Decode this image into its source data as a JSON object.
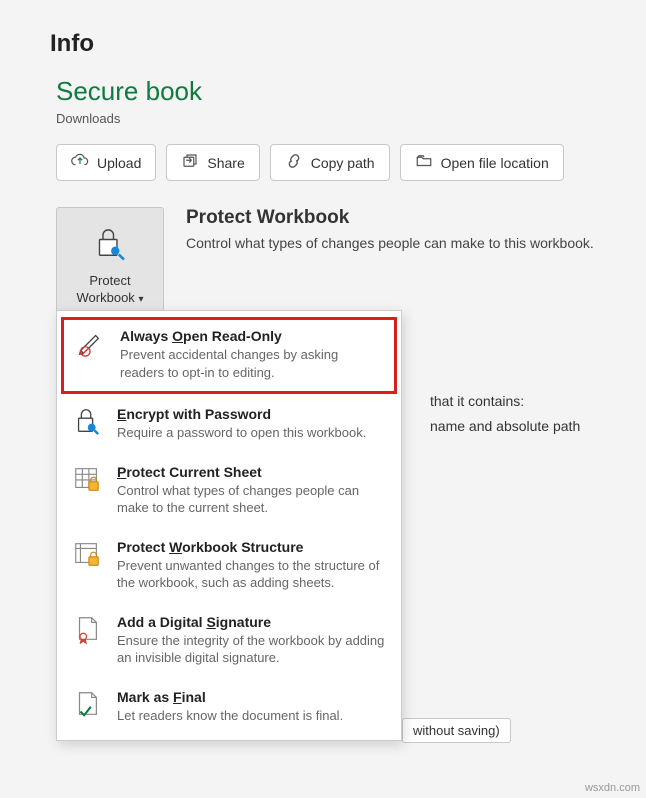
{
  "page_title": "Info",
  "doc_title": "Secure book",
  "doc_location": "Downloads",
  "actions": {
    "upload": "Upload",
    "share": "Share",
    "copy_path": "Copy path",
    "open_location": "Open file location"
  },
  "protect": {
    "button_line1": "Protect",
    "button_line2": "Workbook",
    "heading": "Protect Workbook",
    "desc": "Control what types of changes people can make to this workbook."
  },
  "menu": [
    {
      "title_pre": "Always ",
      "title_u": "O",
      "title_post": "pen Read-Only",
      "desc": "Prevent accidental changes by asking readers to opt-in to editing."
    },
    {
      "title_pre": "",
      "title_u": "E",
      "title_post": "ncrypt with Password",
      "desc": "Require a password to open this workbook."
    },
    {
      "title_pre": "",
      "title_u": "P",
      "title_post": "rotect Current Sheet",
      "desc": "Control what types of changes people can make to the current sheet."
    },
    {
      "title_pre": "Protect ",
      "title_u": "W",
      "title_post": "orkbook Structure",
      "desc": "Prevent unwanted changes to the structure of the workbook, such as adding sheets."
    },
    {
      "title_pre": "Add a Digital ",
      "title_u": "S",
      "title_post": "ignature",
      "desc": "Ensure the integrity of the workbook by adding an invisible digital signature."
    },
    {
      "title_pre": "Mark as ",
      "title_u": "F",
      "title_post": "inal",
      "desc": "Let readers know the document is final."
    }
  ],
  "background": {
    "line1": "that it contains:",
    "line2": "name and absolute path",
    "button_partial": "without saving)"
  },
  "watermark": "wsxdn.com"
}
